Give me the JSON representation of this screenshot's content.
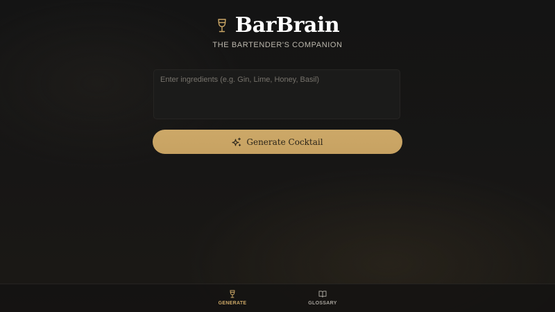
{
  "header": {
    "title": "BarBrain",
    "tagline": "THE BARTENDER'S COMPANION",
    "logo_icon": "wine-glass-icon"
  },
  "ingredients": {
    "placeholder": "Enter ingredients (e.g. Gin, Lime, Honey, Basil)",
    "value": ""
  },
  "generate_button": {
    "label": "Generate Cocktail",
    "icon": "sparkles-icon"
  },
  "nav": {
    "items": [
      {
        "label": "GENERATE",
        "icon": "wine-glass-icon",
        "active": true
      },
      {
        "label": "GLOSSARY",
        "icon": "book-open-icon",
        "active": false
      }
    ]
  },
  "colors": {
    "accent": "#cba766",
    "background": "#151514",
    "field": "#1b1b1a",
    "title": "#ffffff",
    "tagline": "#bdb8ae",
    "nav_inactive": "#a7a39c"
  }
}
